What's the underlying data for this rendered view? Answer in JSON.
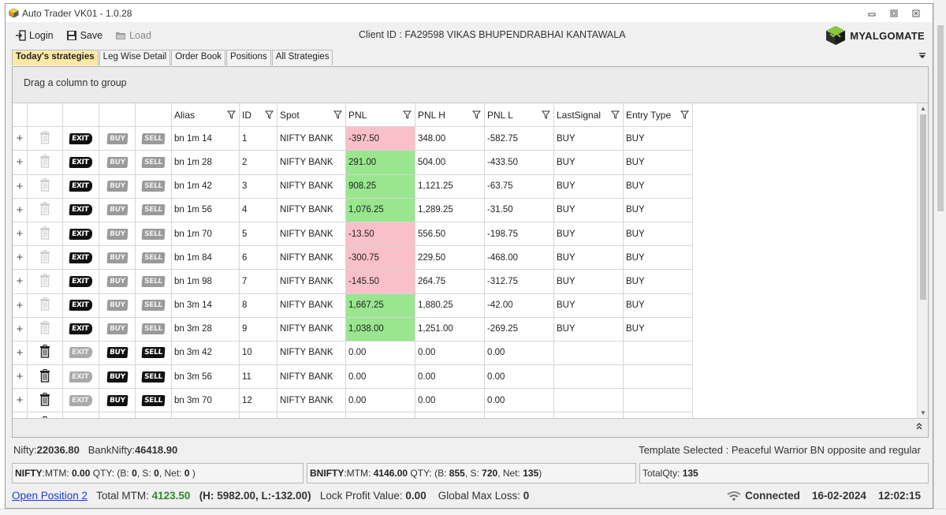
{
  "window": {
    "title": "Auto Trader VK01 - 1.0.28",
    "controls": [
      "minimize",
      "restore",
      "close"
    ]
  },
  "toolbar": {
    "login_label": "Login",
    "save_label": "Save",
    "load_label": "Load",
    "client_id_text": "Client ID : FA29598  VIKAS BHUPENDRABHAI KANTAWALA",
    "logo_text": "MYALGOMATE"
  },
  "tabs": [
    {
      "label": "Today's strategies",
      "active": true
    },
    {
      "label": "Leg Wise Detail",
      "active": false
    },
    {
      "label": "Order Book",
      "active": false
    },
    {
      "label": "Positions",
      "active": false
    },
    {
      "label": "All Strategies",
      "active": false
    }
  ],
  "grid": {
    "group_hint": "Drag a column to group",
    "columns": [
      "Alias",
      "ID",
      "Spot",
      "PNL",
      "PNL H",
      "PNL L",
      "LastSignal",
      "Entry Type"
    ],
    "action_labels": {
      "exit": "EXIT",
      "buy": "BUY",
      "sell": "SELL"
    },
    "rows": [
      {
        "alias": "bn 1m 14",
        "id": "1",
        "spot": "NIFTY BANK",
        "pnl": "-397.50",
        "pnl_h": "348.00",
        "pnl_l": "-582.75",
        "last_signal": "BUY",
        "entry_type": "BUY",
        "pnl_state": "neg",
        "active": true
      },
      {
        "alias": "bn 1m 28",
        "id": "2",
        "spot": "NIFTY BANK",
        "pnl": "291.00",
        "pnl_h": "504.00",
        "pnl_l": "-433.50",
        "last_signal": "BUY",
        "entry_type": "BUY",
        "pnl_state": "pos",
        "active": true
      },
      {
        "alias": "bn 1m 42",
        "id": "3",
        "spot": "NIFTY BANK",
        "pnl": "908.25",
        "pnl_h": "1,121.25",
        "pnl_l": "-63.75",
        "last_signal": "BUY",
        "entry_type": "BUY",
        "pnl_state": "pos",
        "active": true
      },
      {
        "alias": "bn 1m 56",
        "id": "4",
        "spot": "NIFTY BANK",
        "pnl": "1,076.25",
        "pnl_h": "1,289.25",
        "pnl_l": "-31.50",
        "last_signal": "BUY",
        "entry_type": "BUY",
        "pnl_state": "pos",
        "active": true
      },
      {
        "alias": "bn 1m 70",
        "id": "5",
        "spot": "NIFTY BANK",
        "pnl": "-13.50",
        "pnl_h": "556.50",
        "pnl_l": "-198.75",
        "last_signal": "BUY",
        "entry_type": "BUY",
        "pnl_state": "neg",
        "active": true
      },
      {
        "alias": "bn 1m 84",
        "id": "6",
        "spot": "NIFTY BANK",
        "pnl": "-300.75",
        "pnl_h": "229.50",
        "pnl_l": "-468.00",
        "last_signal": "BUY",
        "entry_type": "BUY",
        "pnl_state": "neg",
        "active": true
      },
      {
        "alias": "bn 1m 98",
        "id": "7",
        "spot": "NIFTY BANK",
        "pnl": "-145.50",
        "pnl_h": "264.75",
        "pnl_l": "-312.75",
        "last_signal": "BUY",
        "entry_type": "BUY",
        "pnl_state": "neg",
        "active": true
      },
      {
        "alias": "bn 3m 14",
        "id": "8",
        "spot": "NIFTY BANK",
        "pnl": "1,667.25",
        "pnl_h": "1,880.25",
        "pnl_l": "-42.00",
        "last_signal": "BUY",
        "entry_type": "BUY",
        "pnl_state": "pos",
        "active": true
      },
      {
        "alias": "bn 3m 28",
        "id": "9",
        "spot": "NIFTY BANK",
        "pnl": "1,038.00",
        "pnl_h": "1,251.00",
        "pnl_l": "-269.25",
        "last_signal": "BUY",
        "entry_type": "BUY",
        "pnl_state": "pos",
        "active": true
      },
      {
        "alias": "bn 3m 42",
        "id": "10",
        "spot": "NIFTY BANK",
        "pnl": "0.00",
        "pnl_h": "0.00",
        "pnl_l": "0.00",
        "last_signal": "",
        "entry_type": "",
        "pnl_state": "none",
        "active": false
      },
      {
        "alias": "bn 3m 56",
        "id": "11",
        "spot": "NIFTY BANK",
        "pnl": "0.00",
        "pnl_h": "0.00",
        "pnl_l": "0.00",
        "last_signal": "",
        "entry_type": "",
        "pnl_state": "none",
        "active": false
      },
      {
        "alias": "bn 3m 70",
        "id": "12",
        "spot": "NIFTY BANK",
        "pnl": "0.00",
        "pnl_h": "0.00",
        "pnl_l": "0.00",
        "last_signal": "",
        "entry_type": "",
        "pnl_state": "none",
        "active": false
      },
      {
        "alias": "",
        "id": "",
        "spot": "",
        "pnl": "",
        "pnl_h": "",
        "pnl_l": "",
        "last_signal": "",
        "entry_type": "",
        "pnl_state": "none",
        "active": false
      }
    ]
  },
  "status": {
    "nifty_label": "Nifty:",
    "nifty_value": "22036.80",
    "banknifty_label": "BankNifty:",
    "banknifty_value": "46418.90",
    "template_text": "Template Selected : Peaceful Warrior BN opposite and regular"
  },
  "mtm": {
    "nifty": {
      "name": "NIFTY",
      "mtm_label": ":MTM:",
      "mtm": "0.00",
      "qty_label": "QTY: (B:",
      "b": "0",
      "s_label": ", S:",
      "s": "0",
      "net_label": ", Net:",
      "net": "0",
      "close": ")"
    },
    "bnifty": {
      "name": "BNIFTY",
      "mtm_label": ":MTM:",
      "mtm": "4146.00",
      "qty_label": "QTY: (B:",
      "b": "855",
      "s_label": ", S:",
      "s": "720",
      "net_label": ", Net:",
      "net": "135",
      "close": ")"
    },
    "total_qty_label": "TotalQty:",
    "total_qty": "135"
  },
  "footer": {
    "open_position_link": "Open Position 2",
    "total_mtm_label": "Total MTM:",
    "total_mtm": "4123.50",
    "h_label": "(H:",
    "h_value": "5982.00,",
    "l_label": "L:",
    "l_value": "-132.00)",
    "lock_profit_label": "Lock Profit Value:",
    "lock_profit": "0.00",
    "global_max_loss_label": "Global Max Loss:",
    "global_max_loss": "0",
    "connection": "Connected",
    "date": "16-02-2024",
    "time": "12:02:15"
  },
  "colors": {
    "active_tab": "#fde9a6",
    "pnl_negative": "#f9c0c9",
    "pnl_positive": "#99e68f",
    "mtm_positive": "#2b8a2b",
    "link": "#1a3fcc"
  }
}
